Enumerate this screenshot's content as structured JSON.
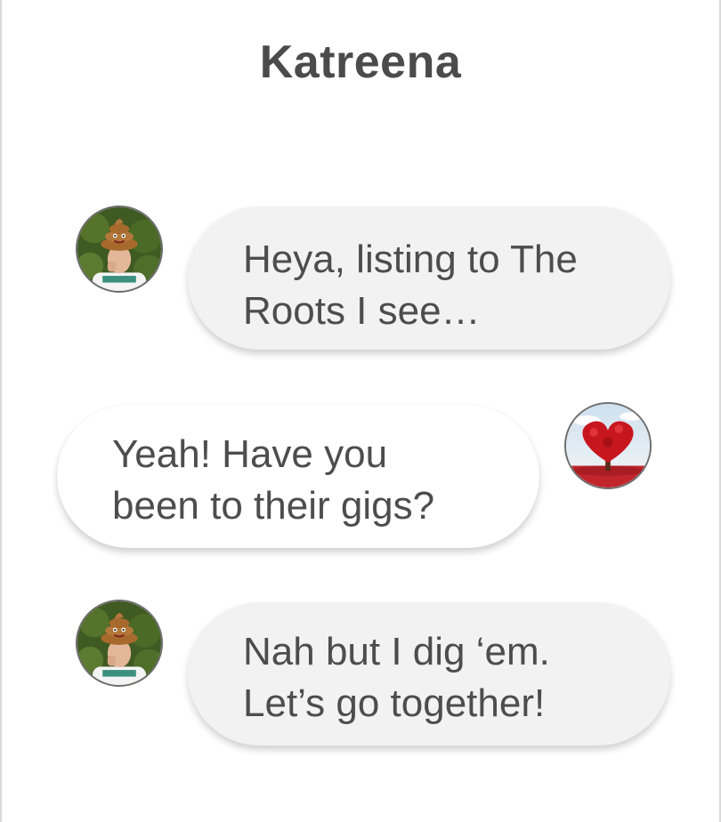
{
  "header": {
    "title": "Katreena"
  },
  "messages": [
    {
      "direction": "incoming",
      "avatar_icon": "man-with-poop-hat-avatar",
      "lines": [
        "Heya, listing to The",
        "Roots I see…"
      ]
    },
    {
      "direction": "outgoing",
      "avatar_icon": "red-heart-tree-avatar",
      "lines": [
        "Yeah! Have you",
        "been to their gigs?"
      ]
    },
    {
      "direction": "incoming",
      "avatar_icon": "man-with-poop-hat-avatar",
      "lines": [
        "Nah but I dig ‘em.",
        "Let’s go together!"
      ]
    }
  ],
  "colors": {
    "incoming_bubble": "#f2f2f2",
    "outgoing_bubble": "#ffffff",
    "text": "#4d4d4d",
    "title": "#4b4b4b"
  }
}
